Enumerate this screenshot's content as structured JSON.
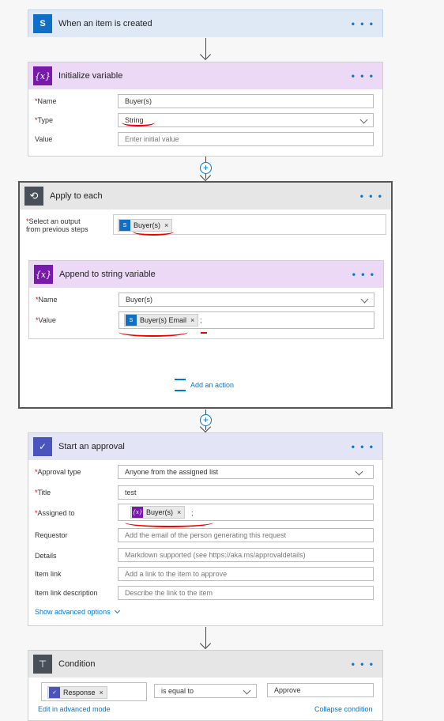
{
  "trigger": {
    "title": "When an item is created",
    "icon": "sharepoint-icon",
    "icon_glyph": "S",
    "color": "#0f6fc6"
  },
  "init_var": {
    "title": "Initialize variable",
    "icon_glyph": "{x}",
    "color": "#7719aa",
    "name_label": "Name",
    "name_value": "Buyer(s)",
    "type_label": "Type",
    "type_value": "String",
    "value_label": "Value",
    "value_placeholder": "Enter initial value"
  },
  "apply": {
    "title": "Apply to each",
    "select_label_1": "Select an output",
    "select_label_2": "from previous steps",
    "token": "Buyer(s)",
    "add_action": "Add an action"
  },
  "append": {
    "title": "Append to string variable",
    "icon_glyph": "{x}",
    "name_label": "Name",
    "name_value": "Buyer(s)",
    "value_label": "Value",
    "value_token": "Buyer(s) Email",
    "value_suffix": ";"
  },
  "approval": {
    "title": "Start an approval",
    "color": "#4b53bc",
    "type_label": "Approval type",
    "type_value": "Anyone from the assigned list",
    "title_label": "Title",
    "title_value": "test",
    "assigned_label": "Assigned to",
    "assigned_token": "Buyer(s)",
    "assigned_suffix": ";",
    "requestor_label": "Requestor",
    "requestor_placeholder": "Add the email of the person generating this request",
    "details_label": "Details",
    "details_placeholder": "Markdown supported (see https://aka.ms/approvaldetails)",
    "itemlink_label": "Item link",
    "itemlink_placeholder": "Add a link to the item to approve",
    "itemdesc_label": "Item link description",
    "itemdesc_placeholder": "Describe the link to the item",
    "advanced": "Show advanced options"
  },
  "condition": {
    "title": "Condition",
    "color": "#484f58",
    "token": "Response",
    "operator": "is equal to",
    "value": "Approve",
    "edit_advanced": "Edit in advanced mode",
    "collapse": "Collapse condition"
  },
  "more": "• • •",
  "required": "*",
  "close": "×"
}
